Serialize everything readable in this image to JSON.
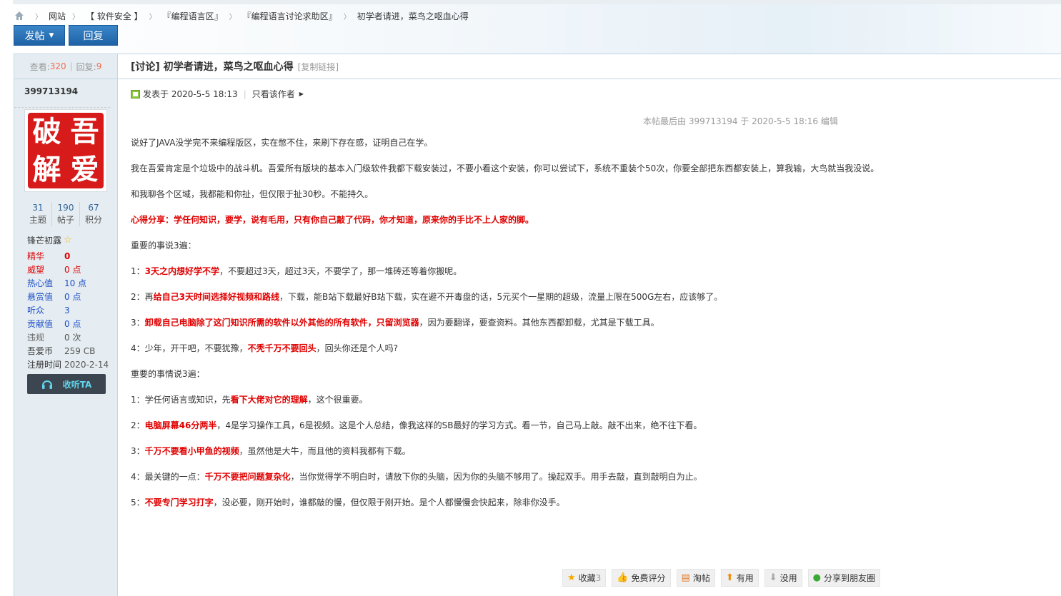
{
  "breadcrumb": {
    "items": [
      "网站",
      "【 软件安全 】",
      "『编程语言区』",
      "『编程语言讨论求助区』",
      "初学者请进，菜鸟之呕血心得"
    ]
  },
  "toolbar": {
    "post_label": "发帖",
    "reply_label": "回复"
  },
  "sidebar": {
    "views_label": "查看:",
    "views": "320",
    "replies_label": "回复:",
    "replies": "9",
    "username": "399713194",
    "avatar_chars": [
      "破",
      "吾",
      "解",
      "爱"
    ],
    "counts": [
      {
        "value": "31",
        "label": "主题"
      },
      {
        "value": "190",
        "label": "帖子"
      },
      {
        "value": "67",
        "label": "积分"
      }
    ],
    "rank": "锋芒初露",
    "props": [
      {
        "key": "精华",
        "value": "0",
        "color": "#e00000"
      },
      {
        "key": "威望",
        "value": "0 点",
        "color": "#e00000"
      },
      {
        "key": "热心值",
        "value": "10 点",
        "color": "#1f50c8"
      },
      {
        "key": "悬赏值",
        "value": "0 点",
        "color": "#1f50c8"
      },
      {
        "key": "听众",
        "value": "3",
        "color": "#1f50c8"
      },
      {
        "key": "贡献值",
        "value": "0 点",
        "color": "#1f50c8"
      },
      {
        "key": "违规",
        "value": "0 次",
        "color": "#666666"
      },
      {
        "key": "吾爱币",
        "value": "259 CB",
        "color": "#333333"
      },
      {
        "key": "注册时间",
        "value": "2020-2-14",
        "color": "#333333"
      }
    ],
    "listen_label": "收听TA"
  },
  "thread": {
    "title": "[讨论] 初学者请进，菜鸟之呕血心得",
    "copy_link": "[复制链接]",
    "posted_at": "发表于 2020-5-5 18:13",
    "only_author": "只看该作者",
    "edited_note": "本帖最后由 399713194 于 2020-5-5 18:16 编辑"
  },
  "post": {
    "lines": [
      [
        {
          "t": "说好了JAVA没学完不来编程版区，实在憋不住，来刷下存在感，证明自己在学。",
          "s": "n"
        }
      ],
      [
        {
          "t": "我在吾爱肯定是个垃圾中的战斗机。吾爱所有版块的基本入门级软件我都下载安装过，不要小看这个安装，你可以尝试下，系统不重装个50次，你要全部把东西都安装上，算我输，大鸟就当我没说。",
          "s": "n"
        }
      ],
      [
        {
          "t": "和我聊各个区域，我都能和你扯，但仅限于扯30秒。不能持久。",
          "s": "n"
        }
      ],
      [
        {
          "t": "心得分享：学任何知识，要学，说有毛用，只有你自己敲了代码，你才知道，原来你的手比不上人家的脚。",
          "s": "r"
        }
      ],
      [
        {
          "t": "重要的事说3遍：",
          "s": "n"
        }
      ],
      [
        {
          "t": "1：",
          "s": "n"
        },
        {
          "t": "3天之内想好学不学",
          "s": "r"
        },
        {
          "t": "，不要超过3天，超过3天，不要学了，那一堆砖还等着你搬呢。",
          "s": "n"
        }
      ],
      [
        {
          "t": "2：再",
          "s": "n"
        },
        {
          "t": "给自己3天时间选择好视频和路线",
          "s": "r"
        },
        {
          "t": "，下载，能B站下载最好B站下载，实在避不开毒盘的话，5元买个一星期的超级，流量上限在500G左右，应该够了。",
          "s": "n"
        }
      ],
      [
        {
          "t": "3：",
          "s": "n"
        },
        {
          "t": "卸载自己电脑除了这门知识所需的软件以外其他的所有软件，只留浏览器",
          "s": "r"
        },
        {
          "t": "，因为要翻译，要查资料。其他东西都卸载，尤其是下载工具。",
          "s": "n"
        }
      ],
      [
        {
          "t": "4：少年，开干吧，不要犹豫，",
          "s": "n"
        },
        {
          "t": "不秃千万不要回头",
          "s": "r"
        },
        {
          "t": "，回头你还是个人吗?",
          "s": "n"
        }
      ],
      [
        {
          "t": "重要的事情说3遍：",
          "s": "n"
        }
      ],
      [
        {
          "t": "1：学任何语言或知识，先",
          "s": "n"
        },
        {
          "t": "看下大佬对它的理解",
          "s": "r"
        },
        {
          "t": "，这个很重要。",
          "s": "n"
        }
      ],
      [
        {
          "t": "2：",
          "s": "n"
        },
        {
          "t": "电脑屏幕46分两半",
          "s": "r"
        },
        {
          "t": "，4是学习操作工具，6是视频。这是个人总结，像我这样的SB最好的学习方式。看一节，自己马上敲。敲不出来，绝不往下看。",
          "s": "n"
        }
      ],
      [
        {
          "t": "3：",
          "s": "n"
        },
        {
          "t": "千万不要看小甲鱼的视频",
          "s": "r"
        },
        {
          "t": "，虽然他是大牛，而且他的资料我都有下载。",
          "s": "n"
        }
      ],
      [
        {
          "t": "4：最关键的一点：",
          "s": "n"
        },
        {
          "t": "千万不要把问题复杂化",
          "s": "r"
        },
        {
          "t": "，当你觉得学不明白时，请放下你的头脑，因为你的头脑不够用了。操起双手。用手去敲，直到敲明白为止。",
          "s": "n"
        }
      ],
      [
        {
          "t": "5：",
          "s": "n"
        },
        {
          "t": "不要专门学习打字",
          "s": "r"
        },
        {
          "t": "，没必要，刚开始时，谁都敲的慢，但仅限于刚开始。是个人都慢慢会快起来，除非你没手。",
          "s": "n"
        }
      ]
    ]
  },
  "actions": {
    "favorite": "收藏",
    "favorite_count": "3",
    "rate": "免费评分",
    "tao": "淘帖",
    "useful": "有用",
    "useless": "没用",
    "share": "分享到朋友圈"
  }
}
